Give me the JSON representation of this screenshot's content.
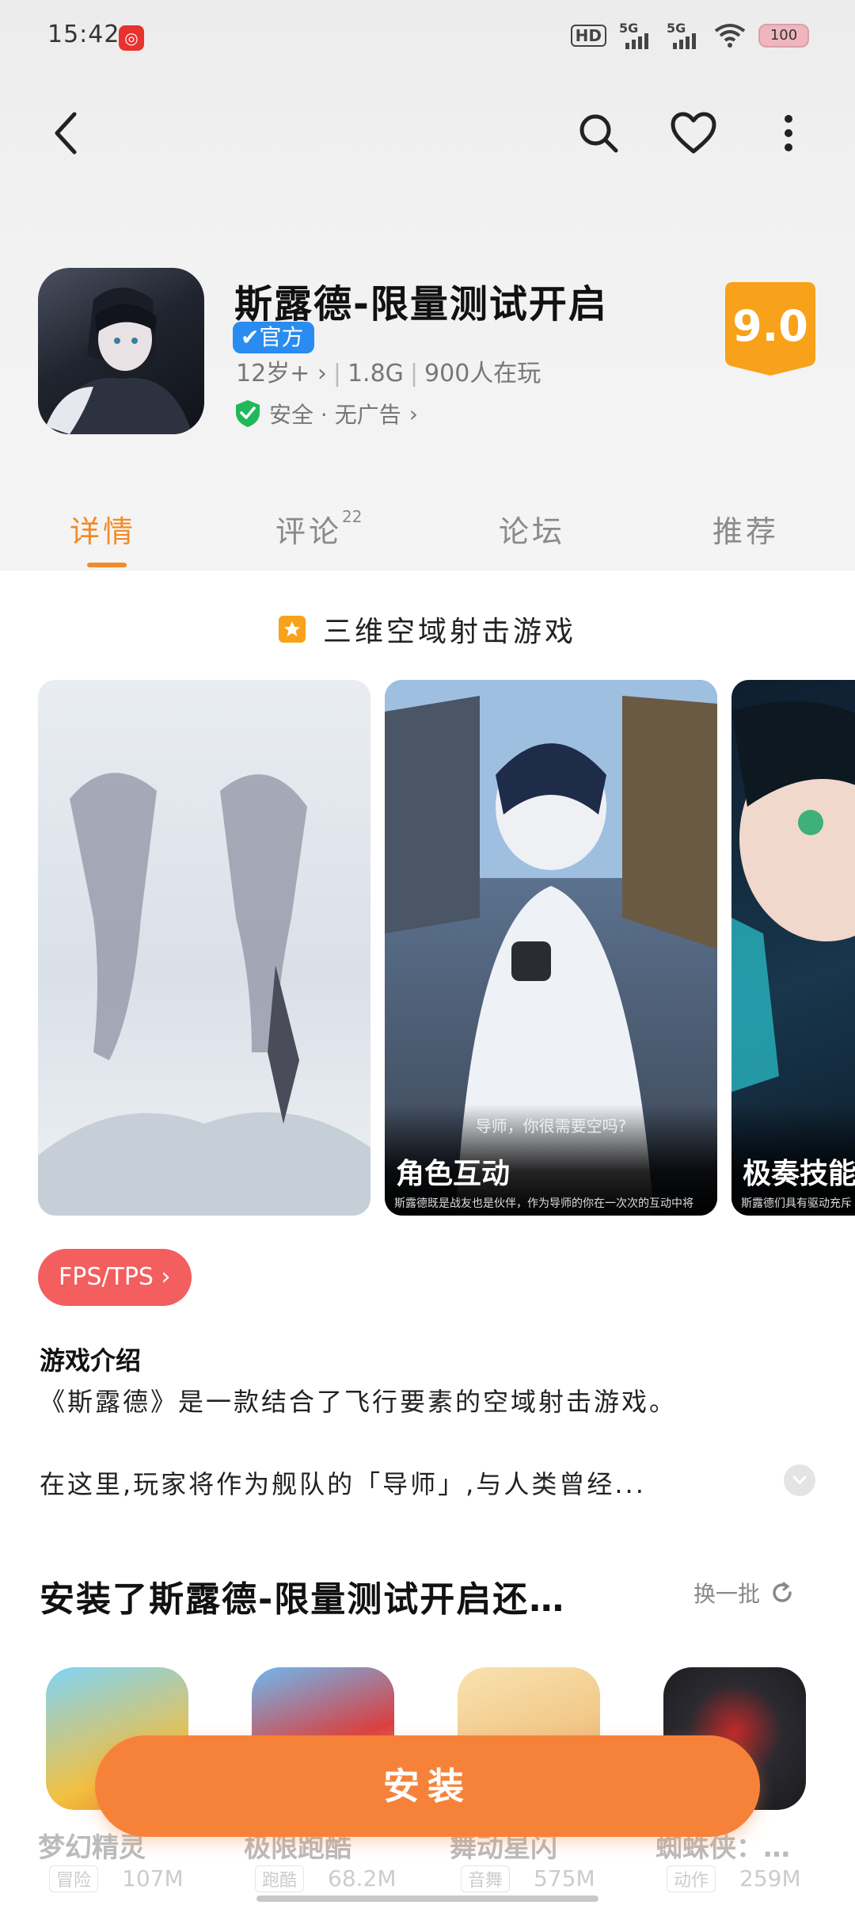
{
  "status_bar": {
    "time": "15:42",
    "hd_label": "HD",
    "signal1_label": "5G",
    "signal2_label": "5G",
    "battery": "100"
  },
  "app_bar": {
    "back_icon": "back-arrow-icon",
    "search_icon": "search-icon",
    "favorite_icon": "heart-icon",
    "more_icon": "more-vertical-icon"
  },
  "app": {
    "title": "斯露德-限量测试开启",
    "official_badge": "官方",
    "age": "12岁+",
    "size": "1.8G",
    "players": "900人在玩",
    "safety": "安全 · 无广告",
    "score": "9.0"
  },
  "tabs": [
    {
      "label": "详情",
      "count": ""
    },
    {
      "label": "评论",
      "count": "22"
    },
    {
      "label": "论坛",
      "count": ""
    },
    {
      "label": "推荐",
      "count": ""
    }
  ],
  "tagline": "三维空域射击游戏",
  "screenshots": [
    {
      "caption": "",
      "subtitle": "",
      "quote": ""
    },
    {
      "caption": "角色互动",
      "subtitle": "斯露德既是战友也是伙伴，作为导师的你在一次次的互动中将",
      "quote": "导师，你很需要空吗?"
    },
    {
      "caption": "极奏技能",
      "subtitle": "斯露德们具有驱动充斥",
      "quote": ""
    }
  ],
  "genre_chip": "FPS/TPS",
  "intro": {
    "title": "游戏介绍",
    "line1": "《斯露德》是一款结合了飞行要素的空域射击游戏。",
    "line2": "在这里,玩家将作为舰队的「导师」,与人类曾经..."
  },
  "recommend": {
    "title": "安装了斯露德-限量测试开启还…",
    "refresh_label": "换一批",
    "items": [
      {
        "name": "梦幻精灵",
        "category": "冒险",
        "size": "107M",
        "color": "#f3c040"
      },
      {
        "name": "极限跑酷",
        "category": "跑酷",
        "size": "68.2M",
        "color": "#d94040"
      },
      {
        "name": "舞动星闪",
        "category": "音舞",
        "size": "575M",
        "color": "#f2c98a"
      },
      {
        "name": "蜘蛛侠：…",
        "category": "动作",
        "size": "259M",
        "color": "#2a2a30"
      }
    ]
  },
  "install_label": "安装",
  "colors": {
    "accent": "#f08c2a",
    "install": "#f6823a",
    "official": "#2a8cf0",
    "genre": "#f35e5e",
    "score": "#f7a21a"
  }
}
